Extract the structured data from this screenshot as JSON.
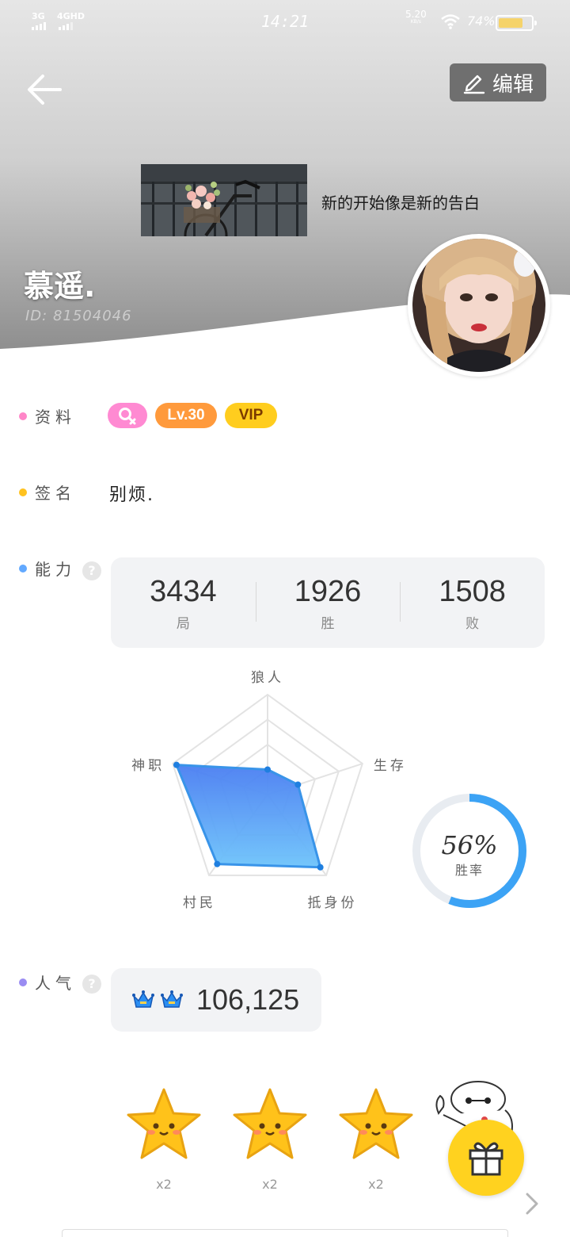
{
  "status_bar": {
    "network_1": "3G",
    "network_2": "4GHD",
    "time": "14:21",
    "speed_value": "5.20",
    "speed_unit": "KB/s",
    "battery_text": "74%",
    "battery_level": 0.74
  },
  "header": {
    "edit_label": "编辑",
    "motto": "新的开始像是新的告白",
    "nickname": "慕遥.",
    "user_id": "ID: 81504046"
  },
  "profile": {
    "info_label": "资料",
    "gender_icon": "female-symbol-icon",
    "level_badge": "Lv.30",
    "vip_badge": "VIP",
    "signature_label": "签名",
    "signature": "别烦."
  },
  "ability": {
    "label": "能力",
    "stats": [
      {
        "value": "3434",
        "label": "局"
      },
      {
        "value": "1926",
        "label": "胜"
      },
      {
        "value": "1508",
        "label": "败"
      }
    ],
    "radar_axes": [
      "狼人",
      "生存",
      "抵身份",
      "村民",
      "神职"
    ],
    "radar_values": [
      0.25,
      0.32,
      0.9,
      0.86,
      0.96
    ],
    "win_rate_text": "56%",
    "win_rate_fraction": 0.56,
    "win_rate_caption": "胜率"
  },
  "popularity": {
    "label": "人气",
    "value": "106,125"
  },
  "gifts": [
    {
      "icon": "star-icon",
      "count": "x2"
    },
    {
      "icon": "star-icon",
      "count": "x2"
    },
    {
      "icon": "star-icon",
      "count": "x2"
    }
  ],
  "colors": {
    "info_dot": "#ff86c8",
    "sign_dot": "#ffc21f",
    "ability_dot": "#62a9ff",
    "popularity_dot": "#9a8cf2",
    "radar_fill": "#3e86f5",
    "ring_accent": "#3ca3f5"
  }
}
